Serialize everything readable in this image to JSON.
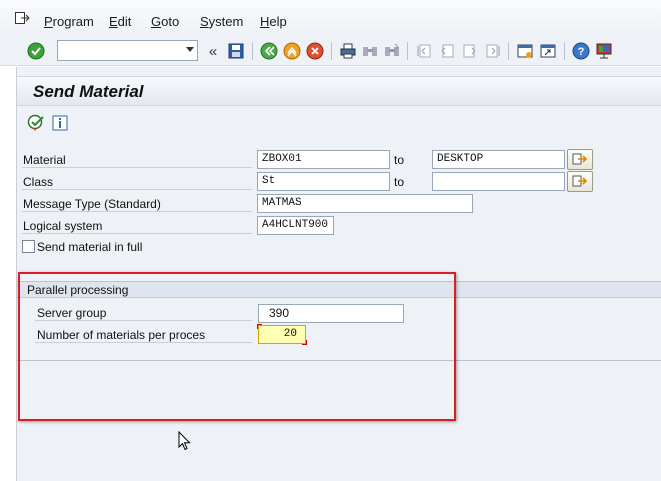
{
  "menubar": {
    "items": [
      {
        "label": "Program",
        "underline": "P",
        "rest": "rogram"
      },
      {
        "label": "Edit",
        "underline": "E",
        "rest": "dit"
      },
      {
        "label": "Goto",
        "underline": "G",
        "rest": "oto"
      },
      {
        "label": "System",
        "underline": "S",
        "rest": "ystem"
      },
      {
        "label": "Help",
        "underline": "H",
        "rest": "elp"
      }
    ]
  },
  "toolbar": {
    "command_field_value": "",
    "icons": [
      "enter-icon",
      "back-icon",
      "save-icon",
      "back-nav-icon",
      "exit-icon",
      "cancel-icon",
      "print-icon",
      "find-icon",
      "find-next-icon",
      "first-page-icon",
      "previous-page-icon",
      "next-page-icon",
      "last-page-icon",
      "new-session-icon",
      "shortcut-icon",
      "help-icon",
      "customize-layout-icon"
    ]
  },
  "screen": {
    "title": "Send Material",
    "app_icons": [
      "execute-icon",
      "info-icon"
    ]
  },
  "form": {
    "material": {
      "label": "Material",
      "from": "ZBOX01",
      "to_label": "to",
      "to": "DESKTOP"
    },
    "class": {
      "label": "Class",
      "from": "St",
      "to_label": "to",
      "to": ""
    },
    "message_type": {
      "label": "Message Type (Standard)",
      "value": "MATMAS"
    },
    "logical_system": {
      "label": "Logical system",
      "value": "A4HCLNT900"
    },
    "send_in_full": {
      "label": "Send material in full",
      "checked": false
    }
  },
  "parallel": {
    "title": "Parallel processing",
    "server_group": {
      "label": "Server group",
      "value": "390"
    },
    "materials_per_process": {
      "label": "Number of materials per proces",
      "value": "20"
    }
  },
  "colors": {
    "highlight_frame": "#d81f26",
    "required_field": "#ffffb4",
    "background": "#eef1f6"
  }
}
